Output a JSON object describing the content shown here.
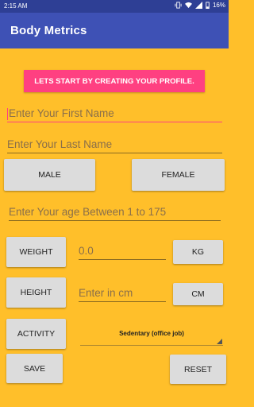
{
  "status": {
    "time": "2:15 AM",
    "battery": "16%"
  },
  "app": {
    "title": "Body Metrics"
  },
  "banner": {
    "text": "LETS START BY CREATING YOUR PROFILE."
  },
  "form": {
    "first_name_placeholder": "Enter Your First Name",
    "last_name_placeholder": "Enter Your Last Name",
    "age_placeholder": "Enter Your age Between 1 to 175",
    "weight_value": "0.0",
    "height_placeholder": "Enter in cm",
    "activity_selected": "Sedentary (office job)"
  },
  "buttons": {
    "male": "MALE",
    "female": "FEMALE",
    "weight": "WEIGHT",
    "kg": "KG",
    "height": "HEIGHT",
    "cm": "CM",
    "activity": "ACTIVITY",
    "save": "SAVE",
    "reset": "RESET"
  },
  "colors": {
    "appbar": "#3E51B5",
    "statusbar": "#2E3F95",
    "background": "#FFBF2A",
    "accent": "#FF4081"
  }
}
